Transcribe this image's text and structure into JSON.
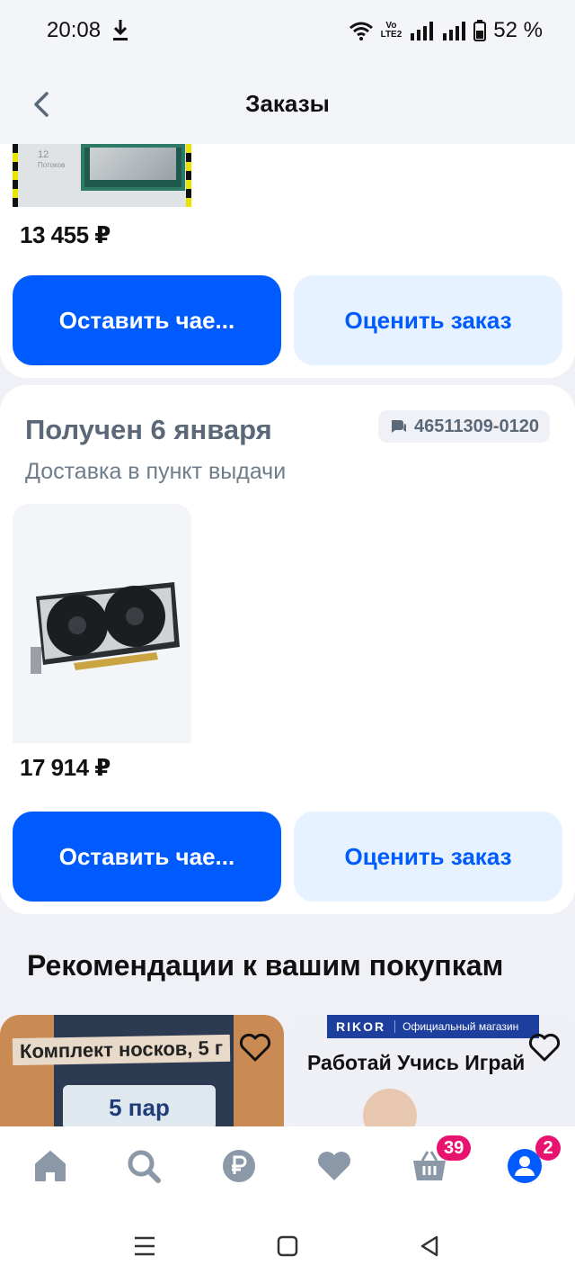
{
  "status_bar": {
    "time": "20:08",
    "volte_top": "Vo",
    "volte_bottom": "LTE2",
    "battery": "52 %"
  },
  "header": {
    "title": "Заказы"
  },
  "order1": {
    "thumb_line1": "12",
    "thumb_line2": "Потоков",
    "price": "13 455 ₽",
    "review_button": "Оставить чае...",
    "rate_button": "Оценить заказ"
  },
  "order2": {
    "status": "Получен 6 января",
    "order_number": "46511309-0120",
    "delivery": "Доставка в пункт выдачи",
    "price": "17 914 ₽",
    "review_button": "Оставить чае...",
    "rate_button": "Оценить заказ"
  },
  "recommendations": {
    "title": "Рекомендации к вашим покупкам",
    "items": [
      {
        "banner": "Комплект носков, 5 г",
        "sub": "5 пар"
      },
      {
        "brand": "RIKOR",
        "brand_tag": "Официальный магазин",
        "banner": "Работай Учись Играй"
      }
    ]
  },
  "bottom_nav": {
    "cart_badge": "39",
    "profile_badge": "2"
  },
  "colors": {
    "accent": "#005bff",
    "badge": "#e8126f",
    "muted": "#5b6877"
  }
}
